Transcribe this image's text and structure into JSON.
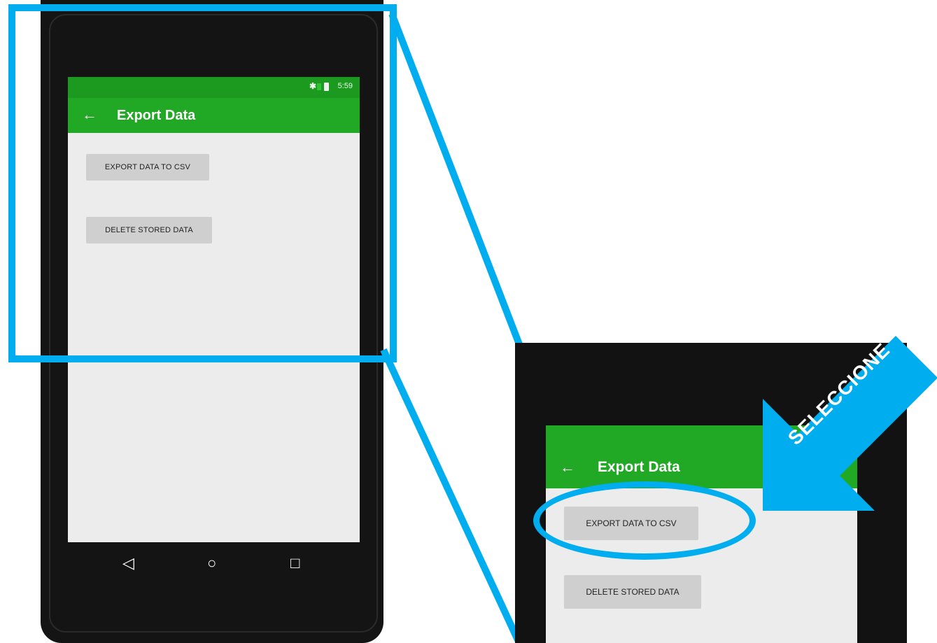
{
  "main_screen": {
    "status_bar": {
      "time": "5:59",
      "bluetooth_icon": "bluetooth-icon",
      "battery_icon": "battery-icon"
    },
    "app_bar": {
      "back_icon": "←",
      "title": "Export Data"
    },
    "buttons": {
      "export_label": "EXPORT DATA TO CSV",
      "delete_label": "DELETE STORED DATA"
    },
    "nav_bar": {
      "back": "◁",
      "home": "○",
      "recents": "□"
    }
  },
  "zoom_screen": {
    "app_bar": {
      "back_icon": "←",
      "title": "Export Data"
    },
    "buttons": {
      "export_label": "EXPORT DATA TO CSV",
      "delete_label": "DELETE STORED DATA"
    }
  },
  "annotation": {
    "callout_label": "SELECCIONE",
    "highlight_color": "#00adef"
  },
  "colors": {
    "app_bar": "#21a825",
    "status_bar": "#1b9a1f",
    "button": "#cfcfcf",
    "screen": "#ececec"
  }
}
